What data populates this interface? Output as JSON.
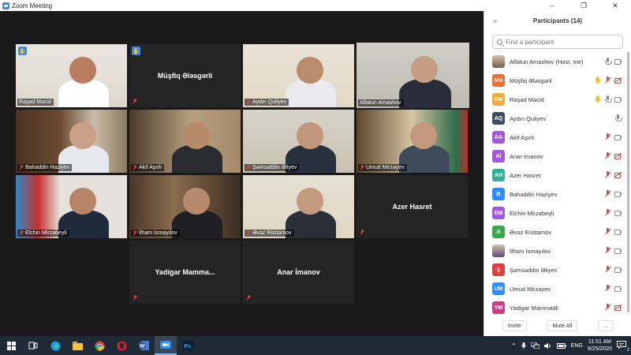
{
  "window": {
    "title": "Zoom Meeting"
  },
  "gallery": {
    "tiles": [
      {
        "id": "rasad",
        "name": "Rəşad Məcid",
        "hand": true,
        "muted": false,
        "video": true
      },
      {
        "id": "musfiq",
        "name": "Müşfiq Ələsgərli",
        "hand": true,
        "muted": true,
        "video": false
      },
      {
        "id": "aydin",
        "name": "Aydın Quliyev",
        "hand": false,
        "muted": true,
        "video": true
      },
      {
        "id": "aflatun",
        "name": "Aflatun Amashov",
        "hand": false,
        "muted": false,
        "video": true,
        "active": true
      },
      {
        "id": "bahaddin",
        "name": "Bahaddin Haziyev",
        "hand": false,
        "muted": true,
        "video": true
      },
      {
        "id": "akif",
        "name": "Akif Aşırlı",
        "hand": false,
        "muted": true,
        "video": true
      },
      {
        "id": "samsaddin",
        "name": "Şəmsəddin Əliyev",
        "hand": false,
        "muted": true,
        "video": true
      },
      {
        "id": "umud",
        "name": "Umud Mirzəyev",
        "hand": false,
        "muted": true,
        "video": true
      },
      {
        "id": "elchin",
        "name": "Elchin Mirzabeyli",
        "hand": false,
        "muted": true,
        "video": true
      },
      {
        "id": "ilham",
        "name": "İlham İsmayılov",
        "hand": false,
        "muted": true,
        "video": true
      },
      {
        "id": "evez",
        "name": "Əvəz Rüstəmov",
        "hand": false,
        "muted": true,
        "video": true
      },
      {
        "id": "azer",
        "name": "Azer Hasret",
        "hand": false,
        "muted": true,
        "video": false
      },
      {
        "id": "yadigar",
        "name": "Yadigar  Mamma...",
        "hand": false,
        "muted": true,
        "video": false
      },
      {
        "id": "anar",
        "name": "Anar İmanov",
        "hand": false,
        "muted": true,
        "video": false
      }
    ]
  },
  "participants": {
    "title": "Participants (14)",
    "search_placeholder": "Find a participant",
    "list": [
      {
        "initials": "",
        "name": "Aflatun Amashov (Host, me)",
        "color": "#7a5c4c",
        "hand": false,
        "mic": "on",
        "cam": "on",
        "photo": true
      },
      {
        "initials": "MƏ",
        "name": "Müşfiq Ələsgərli",
        "color": "#e8733a",
        "hand": true,
        "mic": "off",
        "cam": "off"
      },
      {
        "initials": "RM",
        "name": "Rəşad Məcid",
        "color": "#f2a93b",
        "hand": true,
        "mic": "on",
        "cam": "on"
      },
      {
        "initials": "AQ",
        "name": "Aydın Quliyev",
        "color": "#3d4e63",
        "hand": false,
        "mic": "on",
        "cam": "none"
      },
      {
        "initials": "AA",
        "name": "Akif Aşırlı",
        "color": "#a45ad6",
        "hand": false,
        "mic": "off",
        "cam": "on"
      },
      {
        "initials": "Aİ",
        "name": "Anar İmanov",
        "color": "#a45ad6",
        "hand": false,
        "mic": "off",
        "cam": "off"
      },
      {
        "initials": "AH",
        "name": "Azer Hasret",
        "color": "#2bb39a",
        "hand": false,
        "mic": "off",
        "cam": "off"
      },
      {
        "initials": "B",
        "name": "Bahaddin Haziyev",
        "color": "#2d8cff",
        "hand": false,
        "mic": "off",
        "cam": "on"
      },
      {
        "initials": "EM",
        "name": "Elchin Mirzabeyli",
        "color": "#a45ad6",
        "hand": false,
        "mic": "off",
        "cam": "on"
      },
      {
        "initials": "Ə",
        "name": "Əvəz Rüstəmov",
        "color": "#3aa74a",
        "hand": false,
        "mic": "off",
        "cam": "on"
      },
      {
        "initials": "",
        "name": "İlham İsmayılov",
        "color": "#5a4a7a",
        "hand": false,
        "mic": "off",
        "cam": "on",
        "photo": true
      },
      {
        "initials": "Ş",
        "name": "Şəmsəddin Əliyev",
        "color": "#e04040",
        "hand": false,
        "mic": "off",
        "cam": "on"
      },
      {
        "initials": "UM",
        "name": "Umud Mirzəyev",
        "color": "#2d8cff",
        "hand": false,
        "mic": "off",
        "cam": "on"
      },
      {
        "initials": "YM",
        "name": "Yadigar Mammadli",
        "color": "#c2408c",
        "hand": false,
        "mic": "off",
        "cam": "off"
      }
    ],
    "footer": {
      "invite": "Invite",
      "mute_all": "Mute All",
      "more": "..."
    }
  },
  "taskbar": {
    "language": "ENG",
    "time": "11:51 AM",
    "date": "9/25/2020",
    "notification_count": "2"
  }
}
